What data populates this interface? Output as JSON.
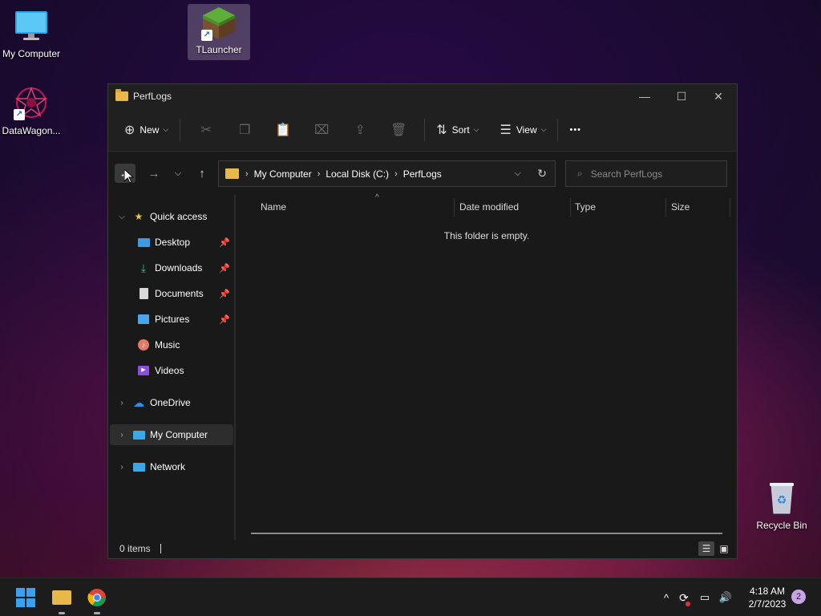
{
  "desktop": {
    "icons": [
      {
        "label": "My Computer"
      },
      {
        "label": "TLauncher"
      },
      {
        "label": "DataWagon..."
      },
      {
        "label": "Recycle Bin"
      }
    ]
  },
  "window": {
    "title": "PerfLogs",
    "controls": {
      "minimize": "—",
      "maximize": "☐",
      "close": "✕"
    },
    "toolbar": {
      "new_label": "New",
      "sort_label": "Sort",
      "view_label": "View",
      "more_label": "•••"
    },
    "breadcrumb": [
      "My Computer",
      "Local Disk (C:)",
      "PerfLogs"
    ],
    "search_placeholder": "Search PerfLogs",
    "nav_pane": {
      "quick_access": "Quick access",
      "items": [
        {
          "label": "Desktop",
          "pinned": true
        },
        {
          "label": "Downloads",
          "pinned": true
        },
        {
          "label": "Documents",
          "pinned": true
        },
        {
          "label": "Pictures",
          "pinned": true
        },
        {
          "label": "Music",
          "pinned": false
        },
        {
          "label": "Videos",
          "pinned": false
        }
      ],
      "onedrive": "OneDrive",
      "my_computer": "My Computer",
      "network": "Network"
    },
    "columns": [
      "Name",
      "Date modified",
      "Type",
      "Size"
    ],
    "empty_message": "This folder is empty.",
    "status_items": "0 items"
  },
  "taskbar": {
    "time": "4:18 AM",
    "date": "2/7/2023",
    "notification_count": "2"
  },
  "colors": {
    "accent": "#0078d4",
    "folder": "#e8b94a",
    "window_bg": "#191919"
  }
}
